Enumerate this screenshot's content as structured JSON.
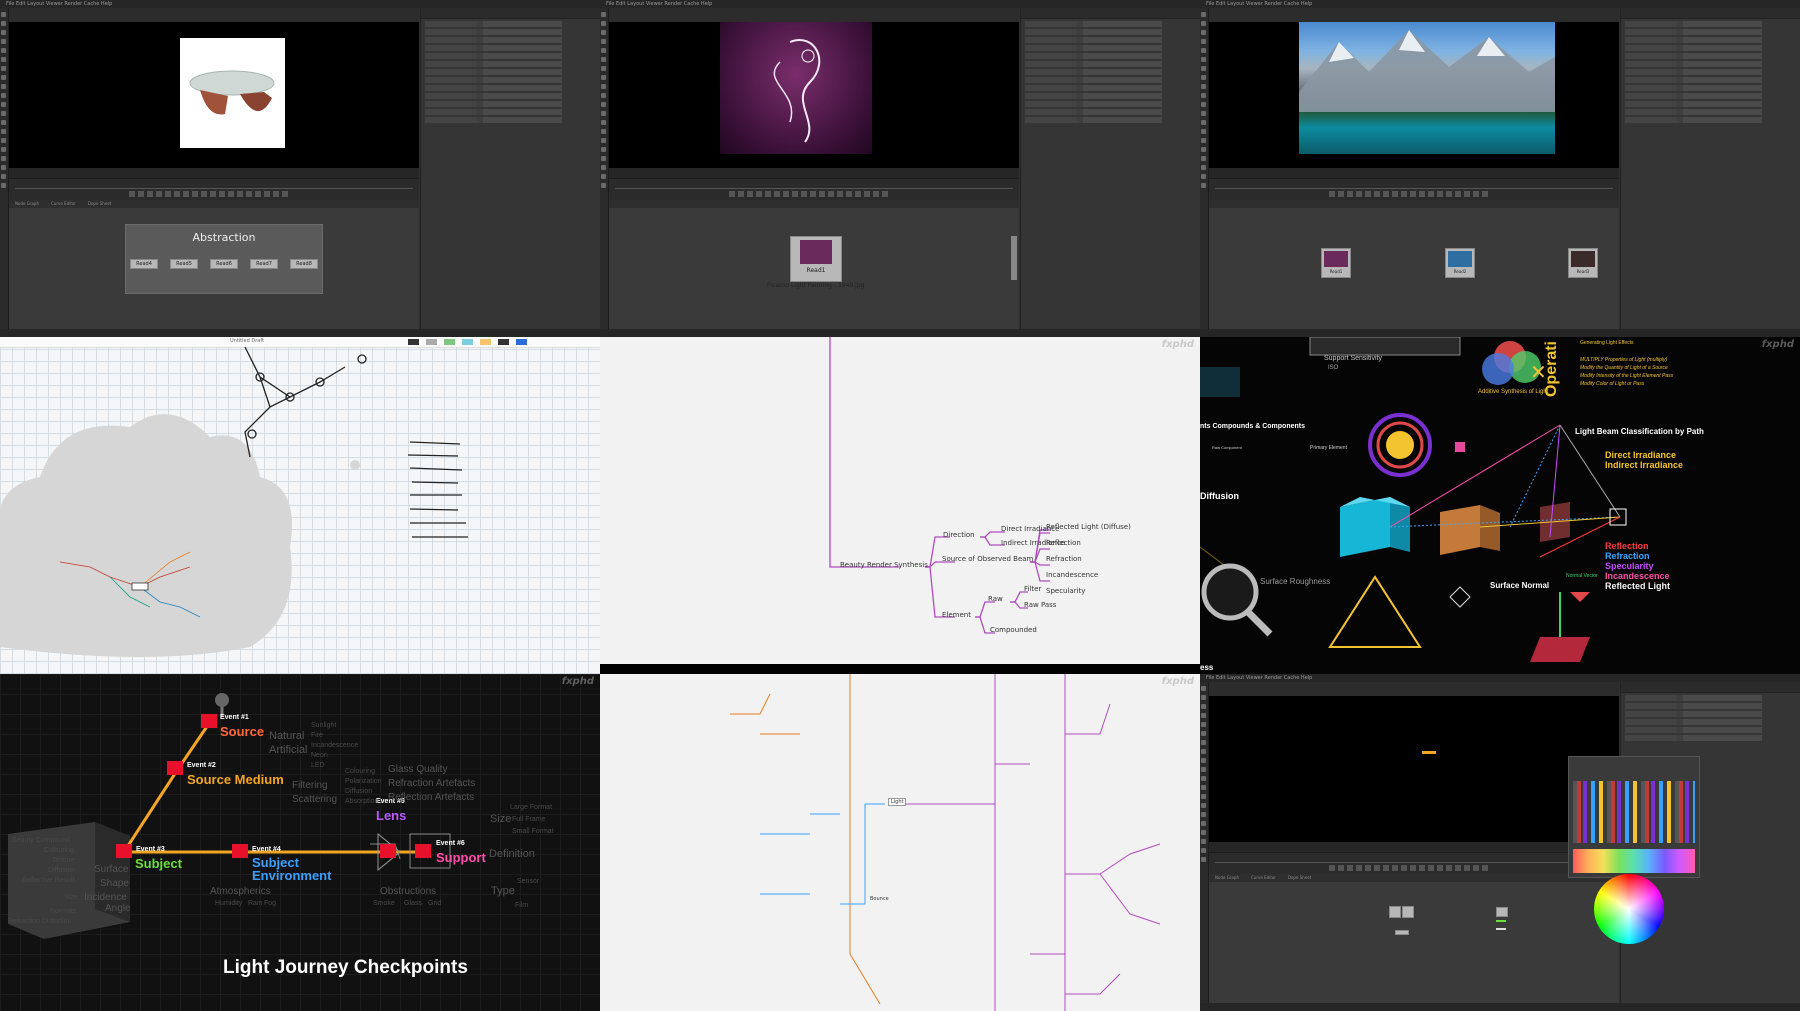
{
  "watermark": "fxphd",
  "panel1": {
    "backdrop_title": "Abstraction",
    "nodes": [
      "Read4",
      "Read5",
      "Read6",
      "Read7",
      "Read8"
    ],
    "dag_tabs": [
      "Node Graph",
      "Curve Editor",
      "Dope Sheet"
    ]
  },
  "panel2": {
    "node_name": "Read1",
    "node_label": "Picasso Light Painting - 1949.jpg"
  },
  "panel3": {
    "nodes": [
      "Read1",
      "Read2",
      "Read3"
    ]
  },
  "panel4": {
    "title": "Untitled Draft"
  },
  "panel5": {
    "root": "Beauty Render Synthesis",
    "branches": [
      {
        "label": "Direction",
        "children": [
          "Direct Irradiance",
          "Indirect Irradiance"
        ]
      },
      {
        "label": "Source of Observed Beam",
        "children": [
          "Reflected Light (Diffuse)",
          "Reflection",
          "Refraction",
          "Incandescence",
          "Specularity"
        ]
      },
      {
        "label": "Element",
        "children": [
          "Raw",
          "Compounded"
        ],
        "raw_children": [
          "Filter",
          "Raw Pass"
        ]
      }
    ]
  },
  "panel6": {
    "support_label": "Support Sensitivity",
    "iso_label": "ISO",
    "operators_label": "Operati",
    "generating_label": "Generating Light Effects",
    "multiply_lines": [
      "MULTIPLY Properties of Light (multiply)",
      "Modify the Quantity of Light of a Source",
      "Modify Intensity of the Light Element Pass",
      "Modify Color of Light or Pass"
    ],
    "additive_label": "Additive Synthesis of Light",
    "compounds_label": "nts Compounds & Components",
    "raw_component": "Raw Component",
    "primary_element": "Primary Element",
    "beam_title": "Light Beam Classification by Path",
    "direct": "Direct Irradiance",
    "indirect": "Indirect Irradiance",
    "diffusion": "Diffusion",
    "surface_roughness": "Surface Roughness",
    "surface_normal": "Surface Normal",
    "normal_vector": "Normal Vector",
    "list": [
      "Reflection",
      "Refraction",
      "Specularity",
      "Incandescence",
      "Reflected Light"
    ],
    "list_colors": [
      "#ff3b3b",
      "#39a6ff",
      "#c44dff",
      "#ff4fa8",
      "#f4f4f4"
    ],
    "bottom_word": "ess"
  },
  "panel7": {
    "title": "Light Journey Checkpoints",
    "events": [
      {
        "tag": "Event #1",
        "name": "Source"
      },
      {
        "tag": "Event #2",
        "name": "Source Medium"
      },
      {
        "tag": "Event #3",
        "name": "Subject"
      },
      {
        "tag": "Event #4",
        "name": "Subject Environment"
      },
      {
        "tag": "Event #5",
        "name": "Lens"
      },
      {
        "tag": "Event #6",
        "name": "Support"
      }
    ],
    "words": [
      "Natural",
      "Artificial",
      "Sunlight",
      "Fire",
      "Incandescence",
      "Neon",
      "LED",
      "Colouring",
      "Polarization",
      "Diffusion",
      "Absorption",
      "Filtering",
      "Scattering",
      "Glass Quality",
      "Refraction Artefacts",
      "Reflection Artefacts",
      "Size",
      "Full Frame",
      "Large Format",
      "Small Format",
      "Definition",
      "Type",
      "Sensor",
      "Film",
      "Surface",
      "Shape",
      "Incidence",
      "Angle",
      "Atmospherics",
      "Humidity",
      "Rain",
      "Fog",
      "Obstructions",
      "Smoke",
      "Glass",
      "Grid",
      "Beauty Compound",
      "Colouring",
      "Texture",
      "Diffusion",
      "Reflective Result",
      "Size",
      "Normals",
      "Refraction Distortion"
    ]
  },
  "panel8": {
    "hub": "Light",
    "hub2": "Bounce"
  },
  "panel9": {
    "dag_tabs": [
      "Node Graph",
      "Curve Editor",
      "Dope Sheet"
    ]
  }
}
